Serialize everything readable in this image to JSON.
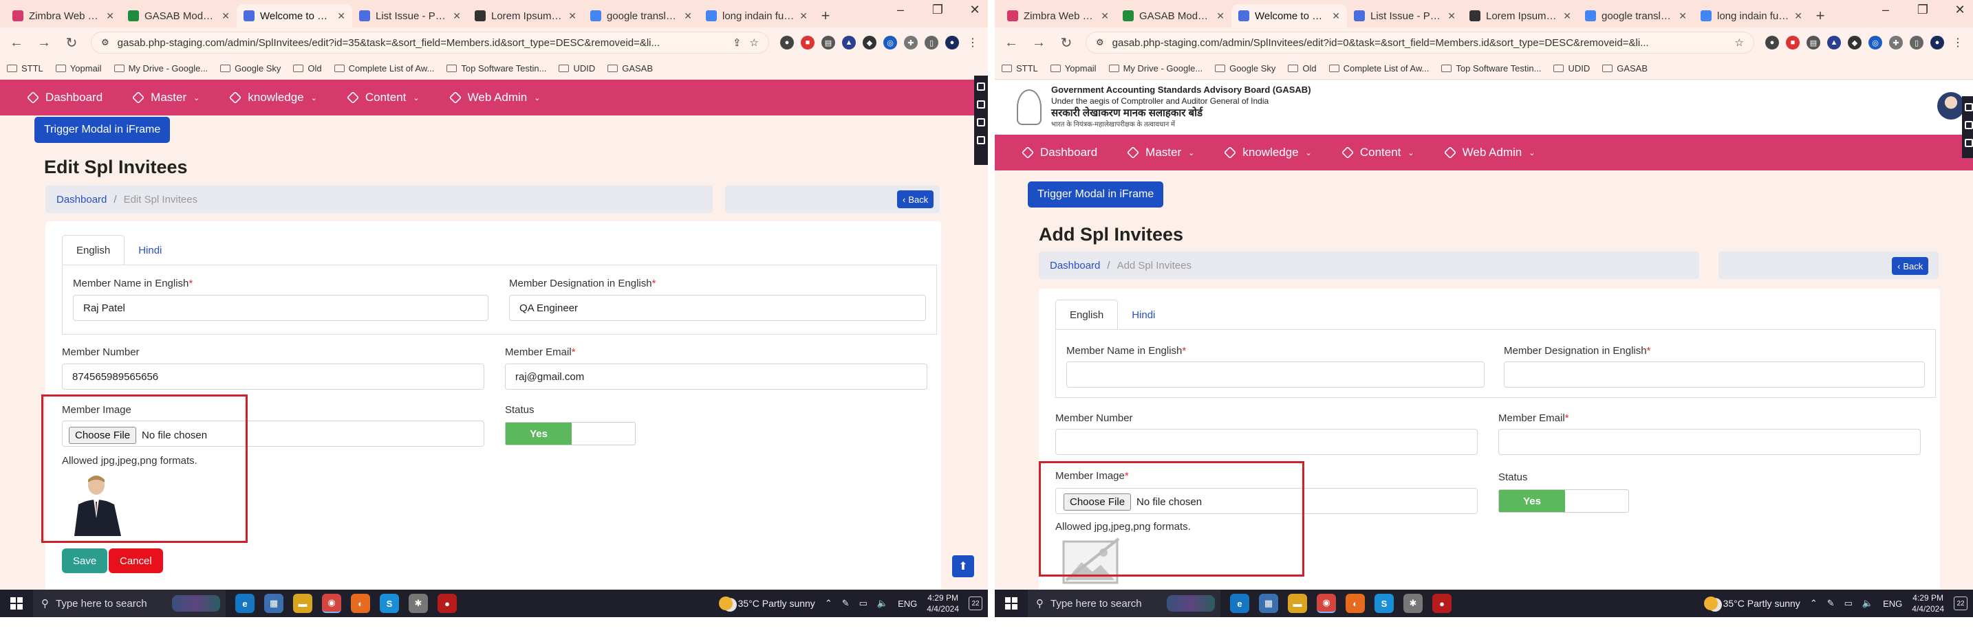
{
  "left": {
    "tabs": [
      {
        "title": "Zimbra Web Clien",
        "icon": "zimbra-icon",
        "color": "#d63a6c"
      },
      {
        "title": "GASAB Module Sh",
        "icon": "sheets-icon",
        "color": "#1e8e3e"
      },
      {
        "title": "Welcome to Short",
        "icon": "globe-icon",
        "color": "#4a6ee0",
        "active": true
      },
      {
        "title": "List Issue - Project",
        "icon": "globe-icon",
        "color": "#4a6ee0"
      },
      {
        "title": "Lorem Ipsum - All",
        "icon": "lorem-icon",
        "color": "#333333"
      },
      {
        "title": "google translate - ",
        "icon": "google-icon",
        "color": "#4285f4"
      },
      {
        "title": "long indain full na",
        "icon": "google-icon",
        "color": "#4285f4"
      }
    ],
    "url": "gasab.php-staging.com/admin/SplInvitees/edit?id=35&task=&sort_field=Members.id&sort_type=DESC&removeid=&li...",
    "bookmarks": [
      "STTL",
      "Yopmail",
      "My Drive - Google...",
      "Google Sky",
      "Old",
      "Complete List of Aw...",
      "Top Software Testin...",
      "UDID",
      "GASAB"
    ],
    "menu": [
      "Dashboard",
      "Master",
      "knowledge",
      "Content",
      "Web Admin"
    ],
    "trigger": "Trigger Modal in iFrame",
    "title": "Edit Spl Invitees",
    "breadcrumb": {
      "home": "Dashboard",
      "current": "Edit Spl Invitees"
    },
    "back": "Back",
    "form_tabs": [
      "English",
      "Hindi"
    ],
    "fields": {
      "name_label": "Member Name in English",
      "name_value": "Raj Patel",
      "designation_label": "Member Designation in English",
      "designation_value": "QA Engineer",
      "number_label": "Member Number",
      "number_value": "874565989565656",
      "email_label": "Member Email",
      "email_value": "raj@gmail.com",
      "image_label": "Member Image",
      "choose_file": "Choose File",
      "no_file": "No file chosen",
      "hint": "Allowed jpg,jpeg,png formats.",
      "status_label": "Status",
      "status_value": "Yes"
    },
    "buttons": {
      "save": "Save",
      "cancel": "Cancel"
    }
  },
  "right": {
    "tabs": [
      {
        "title": "Zimbra Web Clien",
        "icon": "zimbra-icon",
        "color": "#d63a6c"
      },
      {
        "title": "GASAB Module Sh",
        "icon": "sheets-icon",
        "color": "#1e8e3e"
      },
      {
        "title": "Welcome to Short",
        "icon": "globe-icon",
        "color": "#4a6ee0",
        "active": true
      },
      {
        "title": "List Issue - Project",
        "icon": "globe-icon",
        "color": "#4a6ee0"
      },
      {
        "title": "Lorem Ipsum - All",
        "icon": "lorem-icon",
        "color": "#333333"
      },
      {
        "title": "google translate - ",
        "icon": "google-icon",
        "color": "#4285f4"
      },
      {
        "title": "long indain full na",
        "icon": "google-icon",
        "color": "#4285f4"
      }
    ],
    "url": "gasab.php-staging.com/admin/SplInvitees/edit?id=0&task=&sort_field=Members.id&sort_type=DESC&removeid=&li...",
    "bookmarks": [
      "STTL",
      "Yopmail",
      "My Drive - Google...",
      "Google Sky",
      "Old",
      "Complete List of Aw...",
      "Top Software Testin...",
      "UDID",
      "GASAB"
    ],
    "gov": {
      "line1": "Government Accounting Standards Advisory Board (GASAB)",
      "line2": "Under the aegis of Comptroller and Auditor General of India",
      "line3": "सरकारी लेखाकरण मानक सलाहकार बोर्ड",
      "line4": "भारत के नियंत्रक-महालेखापरीक्षक के तत्वावधान में"
    },
    "menu": [
      "Dashboard",
      "Master",
      "knowledge",
      "Content",
      "Web Admin"
    ],
    "trigger": "Trigger Modal in iFrame",
    "title": "Add Spl Invitees",
    "breadcrumb": {
      "home": "Dashboard",
      "current": "Add Spl Invitees"
    },
    "back": "Back",
    "form_tabs": [
      "English",
      "Hindi"
    ],
    "fields": {
      "name_label": "Member Name in English",
      "designation_label": "Member Designation in English",
      "number_label": "Member Number",
      "email_label": "Member Email",
      "image_label": "Member Image",
      "choose_file": "Choose File",
      "no_file": "No file chosen",
      "hint": "Allowed jpg,jpeg,png formats.",
      "status_label": "Status",
      "status_value": "Yes"
    }
  },
  "taskbar": {
    "search_placeholder": "Type here to search",
    "weather": "35°C  Partly sunny",
    "lang": "ENG",
    "time": "4:29 PM",
    "date": "4/4/2024",
    "notif_count": "22"
  },
  "colors": {
    "accent": "#d63a6c",
    "primary": "#1d4fc4",
    "success": "#5cb85c",
    "danger": "#e8101a",
    "save": "#2a9d8f"
  }
}
